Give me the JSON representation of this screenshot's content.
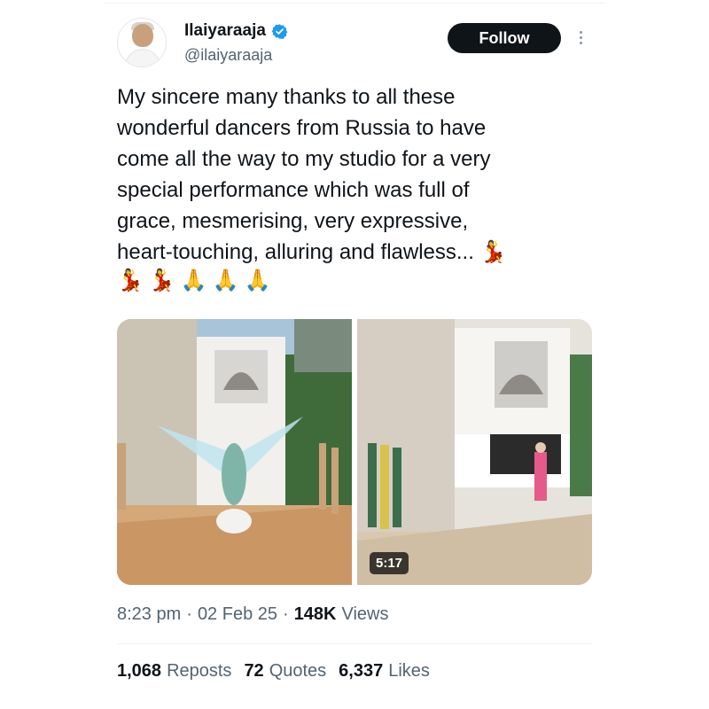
{
  "user": {
    "display_name": "Ilaiyaraaja",
    "handle": "@ilaiyaraaja",
    "verified": true,
    "verified_color": "#1d9bf0"
  },
  "follow_label": "Follow",
  "tweet": {
    "text": "My sincere many thanks to all these\nwonderful dancers from Russia to have\ncome all the way to my studio for a very\nspecial performance which was full of\ngrace, mesmerising, very expressive,\nheart-touching, alluring and flawless... 💃",
    "emojis": [
      "💃",
      "💃",
      "🙏",
      "🙏",
      "🙏"
    ]
  },
  "media": {
    "video_duration": "5:17"
  },
  "meta": {
    "time": "8:23 pm",
    "separator": "·",
    "date": "02 Feb 25",
    "views_count": "148K",
    "views_label": "Views"
  },
  "stats": {
    "reposts_count": "1,068",
    "reposts_label": "Reposts",
    "quotes_count": "72",
    "quotes_label": "Quotes",
    "likes_count": "6,337",
    "likes_label": "Likes"
  },
  "colors": {
    "text_primary": "#0f1419",
    "text_secondary": "#536471",
    "follow_bg": "#0f1419"
  }
}
